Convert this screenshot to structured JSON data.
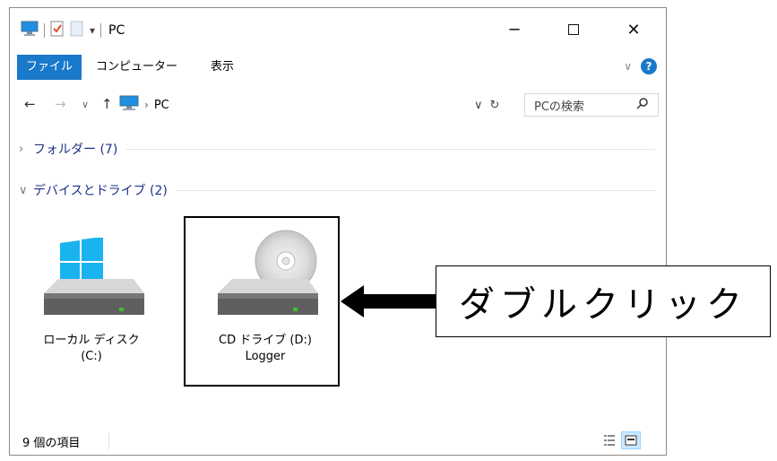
{
  "window": {
    "title": "PC",
    "controls": [
      "minimize-icon",
      "maximize-icon",
      "close-icon"
    ]
  },
  "ribbon": {
    "tabs": [
      {
        "label": "ファイル",
        "active": true
      },
      {
        "label": "コンピューター",
        "active": false
      },
      {
        "label": "表示",
        "active": false
      }
    ],
    "help_icon": "?"
  },
  "address_bar": {
    "path_label": "PC",
    "search_placeholder": "PCの検索"
  },
  "groups": [
    {
      "label": "フォルダー (7)",
      "expanded": false
    },
    {
      "label": "デバイスとドライブ (2)",
      "expanded": true
    }
  ],
  "drives": [
    {
      "name": "ローカル ディスク",
      "sub": "(C:)",
      "icon": "windows-drive-icon"
    },
    {
      "name": "CD ドライブ (D:)",
      "sub": "Logger",
      "icon": "cd-drive-icon"
    }
  ],
  "status": {
    "item_count": "9 個の項目"
  },
  "annotation": {
    "text": "ダブルクリック"
  },
  "colors": {
    "accent": "#1979ca",
    "header_text": "#1e3287",
    "drive_led": "#39c427"
  }
}
